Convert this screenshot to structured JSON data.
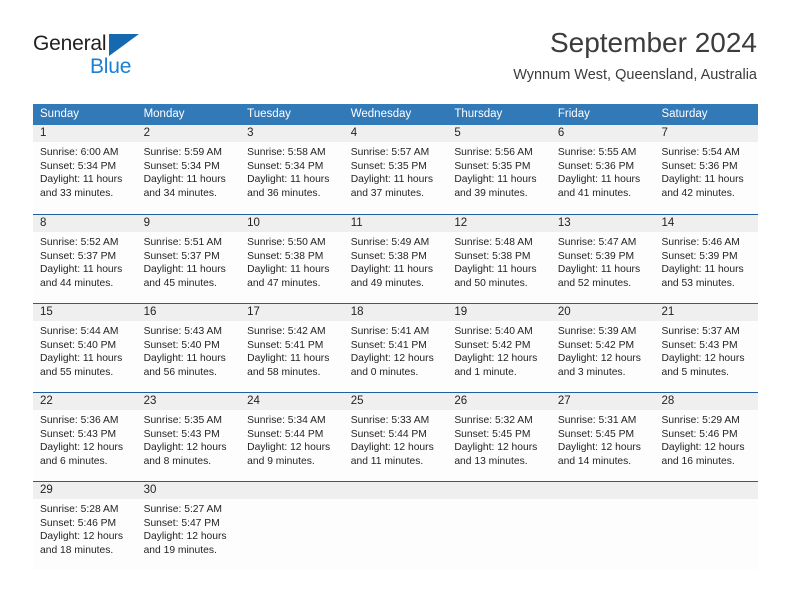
{
  "brand": {
    "name_part1": "General",
    "name_part2": "Blue"
  },
  "header": {
    "title": "September 2024",
    "location": "Wynnum West, Queensland, Australia"
  },
  "colors": {
    "header_blue": "#3279b8",
    "row_rule_blue": "#1f5fa0",
    "day_band_gray": "#efefef",
    "brand_blue": "#1c7fd4",
    "text": "#231f20"
  },
  "weekdays": [
    "Sunday",
    "Monday",
    "Tuesday",
    "Wednesday",
    "Thursday",
    "Friday",
    "Saturday"
  ],
  "weeks": [
    [
      {
        "day": "1",
        "sunrise": "Sunrise: 6:00 AM",
        "sunset": "Sunset: 5:34 PM",
        "daylight": "Daylight: 11 hours and 33 minutes."
      },
      {
        "day": "2",
        "sunrise": "Sunrise: 5:59 AM",
        "sunset": "Sunset: 5:34 PM",
        "daylight": "Daylight: 11 hours and 34 minutes."
      },
      {
        "day": "3",
        "sunrise": "Sunrise: 5:58 AM",
        "sunset": "Sunset: 5:34 PM",
        "daylight": "Daylight: 11 hours and 36 minutes."
      },
      {
        "day": "4",
        "sunrise": "Sunrise: 5:57 AM",
        "sunset": "Sunset: 5:35 PM",
        "daylight": "Daylight: 11 hours and 37 minutes."
      },
      {
        "day": "5",
        "sunrise": "Sunrise: 5:56 AM",
        "sunset": "Sunset: 5:35 PM",
        "daylight": "Daylight: 11 hours and 39 minutes."
      },
      {
        "day": "6",
        "sunrise": "Sunrise: 5:55 AM",
        "sunset": "Sunset: 5:36 PM",
        "daylight": "Daylight: 11 hours and 41 minutes."
      },
      {
        "day": "7",
        "sunrise": "Sunrise: 5:54 AM",
        "sunset": "Sunset: 5:36 PM",
        "daylight": "Daylight: 11 hours and 42 minutes."
      }
    ],
    [
      {
        "day": "8",
        "sunrise": "Sunrise: 5:52 AM",
        "sunset": "Sunset: 5:37 PM",
        "daylight": "Daylight: 11 hours and 44 minutes."
      },
      {
        "day": "9",
        "sunrise": "Sunrise: 5:51 AM",
        "sunset": "Sunset: 5:37 PM",
        "daylight": "Daylight: 11 hours and 45 minutes."
      },
      {
        "day": "10",
        "sunrise": "Sunrise: 5:50 AM",
        "sunset": "Sunset: 5:38 PM",
        "daylight": "Daylight: 11 hours and 47 minutes."
      },
      {
        "day": "11",
        "sunrise": "Sunrise: 5:49 AM",
        "sunset": "Sunset: 5:38 PM",
        "daylight": "Daylight: 11 hours and 49 minutes."
      },
      {
        "day": "12",
        "sunrise": "Sunrise: 5:48 AM",
        "sunset": "Sunset: 5:38 PM",
        "daylight": "Daylight: 11 hours and 50 minutes."
      },
      {
        "day": "13",
        "sunrise": "Sunrise: 5:47 AM",
        "sunset": "Sunset: 5:39 PM",
        "daylight": "Daylight: 11 hours and 52 minutes."
      },
      {
        "day": "14",
        "sunrise": "Sunrise: 5:46 AM",
        "sunset": "Sunset: 5:39 PM",
        "daylight": "Daylight: 11 hours and 53 minutes."
      }
    ],
    [
      {
        "day": "15",
        "sunrise": "Sunrise: 5:44 AM",
        "sunset": "Sunset: 5:40 PM",
        "daylight": "Daylight: 11 hours and 55 minutes."
      },
      {
        "day": "16",
        "sunrise": "Sunrise: 5:43 AM",
        "sunset": "Sunset: 5:40 PM",
        "daylight": "Daylight: 11 hours and 56 minutes."
      },
      {
        "day": "17",
        "sunrise": "Sunrise: 5:42 AM",
        "sunset": "Sunset: 5:41 PM",
        "daylight": "Daylight: 11 hours and 58 minutes."
      },
      {
        "day": "18",
        "sunrise": "Sunrise: 5:41 AM",
        "sunset": "Sunset: 5:41 PM",
        "daylight": "Daylight: 12 hours and 0 minutes."
      },
      {
        "day": "19",
        "sunrise": "Sunrise: 5:40 AM",
        "sunset": "Sunset: 5:42 PM",
        "daylight": "Daylight: 12 hours and 1 minute."
      },
      {
        "day": "20",
        "sunrise": "Sunrise: 5:39 AM",
        "sunset": "Sunset: 5:42 PM",
        "daylight": "Daylight: 12 hours and 3 minutes."
      },
      {
        "day": "21",
        "sunrise": "Sunrise: 5:37 AM",
        "sunset": "Sunset: 5:43 PM",
        "daylight": "Daylight: 12 hours and 5 minutes."
      }
    ],
    [
      {
        "day": "22",
        "sunrise": "Sunrise: 5:36 AM",
        "sunset": "Sunset: 5:43 PM",
        "daylight": "Daylight: 12 hours and 6 minutes."
      },
      {
        "day": "23",
        "sunrise": "Sunrise: 5:35 AM",
        "sunset": "Sunset: 5:43 PM",
        "daylight": "Daylight: 12 hours and 8 minutes."
      },
      {
        "day": "24",
        "sunrise": "Sunrise: 5:34 AM",
        "sunset": "Sunset: 5:44 PM",
        "daylight": "Daylight: 12 hours and 9 minutes."
      },
      {
        "day": "25",
        "sunrise": "Sunrise: 5:33 AM",
        "sunset": "Sunset: 5:44 PM",
        "daylight": "Daylight: 12 hours and 11 minutes."
      },
      {
        "day": "26",
        "sunrise": "Sunrise: 5:32 AM",
        "sunset": "Sunset: 5:45 PM",
        "daylight": "Daylight: 12 hours and 13 minutes."
      },
      {
        "day": "27",
        "sunrise": "Sunrise: 5:31 AM",
        "sunset": "Sunset: 5:45 PM",
        "daylight": "Daylight: 12 hours and 14 minutes."
      },
      {
        "day": "28",
        "sunrise": "Sunrise: 5:29 AM",
        "sunset": "Sunset: 5:46 PM",
        "daylight": "Daylight: 12 hours and 16 minutes."
      }
    ],
    [
      {
        "day": "29",
        "sunrise": "Sunrise: 5:28 AM",
        "sunset": "Sunset: 5:46 PM",
        "daylight": "Daylight: 12 hours and 18 minutes."
      },
      {
        "day": "30",
        "sunrise": "Sunrise: 5:27 AM",
        "sunset": "Sunset: 5:47 PM",
        "daylight": "Daylight: 12 hours and 19 minutes."
      },
      {
        "day": "",
        "sunrise": "",
        "sunset": "",
        "daylight": ""
      },
      {
        "day": "",
        "sunrise": "",
        "sunset": "",
        "daylight": ""
      },
      {
        "day": "",
        "sunrise": "",
        "sunset": "",
        "daylight": ""
      },
      {
        "day": "",
        "sunrise": "",
        "sunset": "",
        "daylight": ""
      },
      {
        "day": "",
        "sunrise": "",
        "sunset": "",
        "daylight": ""
      }
    ]
  ]
}
